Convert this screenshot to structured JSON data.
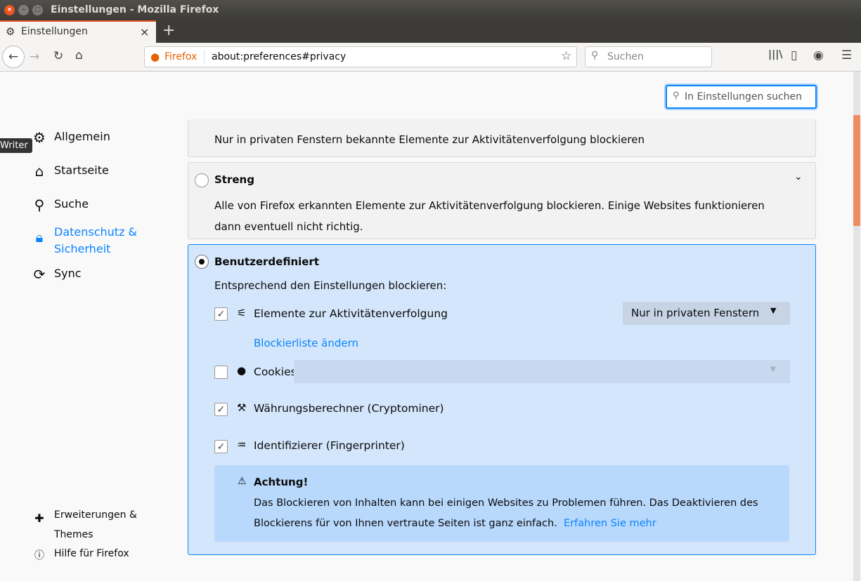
{
  "window": {
    "title": "Einstellungen - Mozilla Firefox"
  },
  "tab": {
    "label": "Einstellungen"
  },
  "urlbar": {
    "identity": "Firefox",
    "url": "about:preferences#privacy"
  },
  "searchbar": {
    "placeholder": "Suchen"
  },
  "prefs_search": {
    "placeholder": "In Einstellungen suchen"
  },
  "tooltip": "Writer",
  "sidebar": {
    "items": [
      {
        "label": "Allgemein"
      },
      {
        "label": "Startseite"
      },
      {
        "label": "Suche"
      },
      {
        "label": "Datenschutz & Sicherheit"
      },
      {
        "label": "Sync"
      }
    ],
    "footer": [
      {
        "label": "Erweiterungen & Themes"
      },
      {
        "label": "Hilfe für Firefox"
      }
    ]
  },
  "standard": {
    "desc": "Nur in privaten Fenstern bekannte Elemente zur Aktivitätenverfolgung blockieren"
  },
  "strict": {
    "title": "Streng",
    "desc": "Alle von Firefox erkannten Elemente zur Aktivitätenverfolgung blockieren. Einige Websites funktionieren dann eventuell nicht richtig."
  },
  "custom": {
    "title": "Benutzerdefiniert",
    "subtitle": "Entsprechend den Einstellungen blockieren:",
    "tracking": {
      "label": "Elemente zur Aktivitätenverfolgung",
      "checked": true,
      "select": "Nur in privaten Fenstern",
      "link": "Blockierliste ändern"
    },
    "cookies": {
      "label": "Cookies",
      "checked": false
    },
    "crypto": {
      "label": "Währungsberechner (Cryptominer)",
      "checked": true
    },
    "finger": {
      "label": "Identifizierer (Fingerprinter)",
      "checked": true
    },
    "warning": {
      "title": "Achtung!",
      "text": "Das Blockieren von Inhalten kann bei einigen Websites zu Problemen führen. Das Deaktivieren des Blockierens für von Ihnen vertraute Seiten ist ganz einfach.",
      "link": "Erfahren Sie mehr"
    }
  }
}
